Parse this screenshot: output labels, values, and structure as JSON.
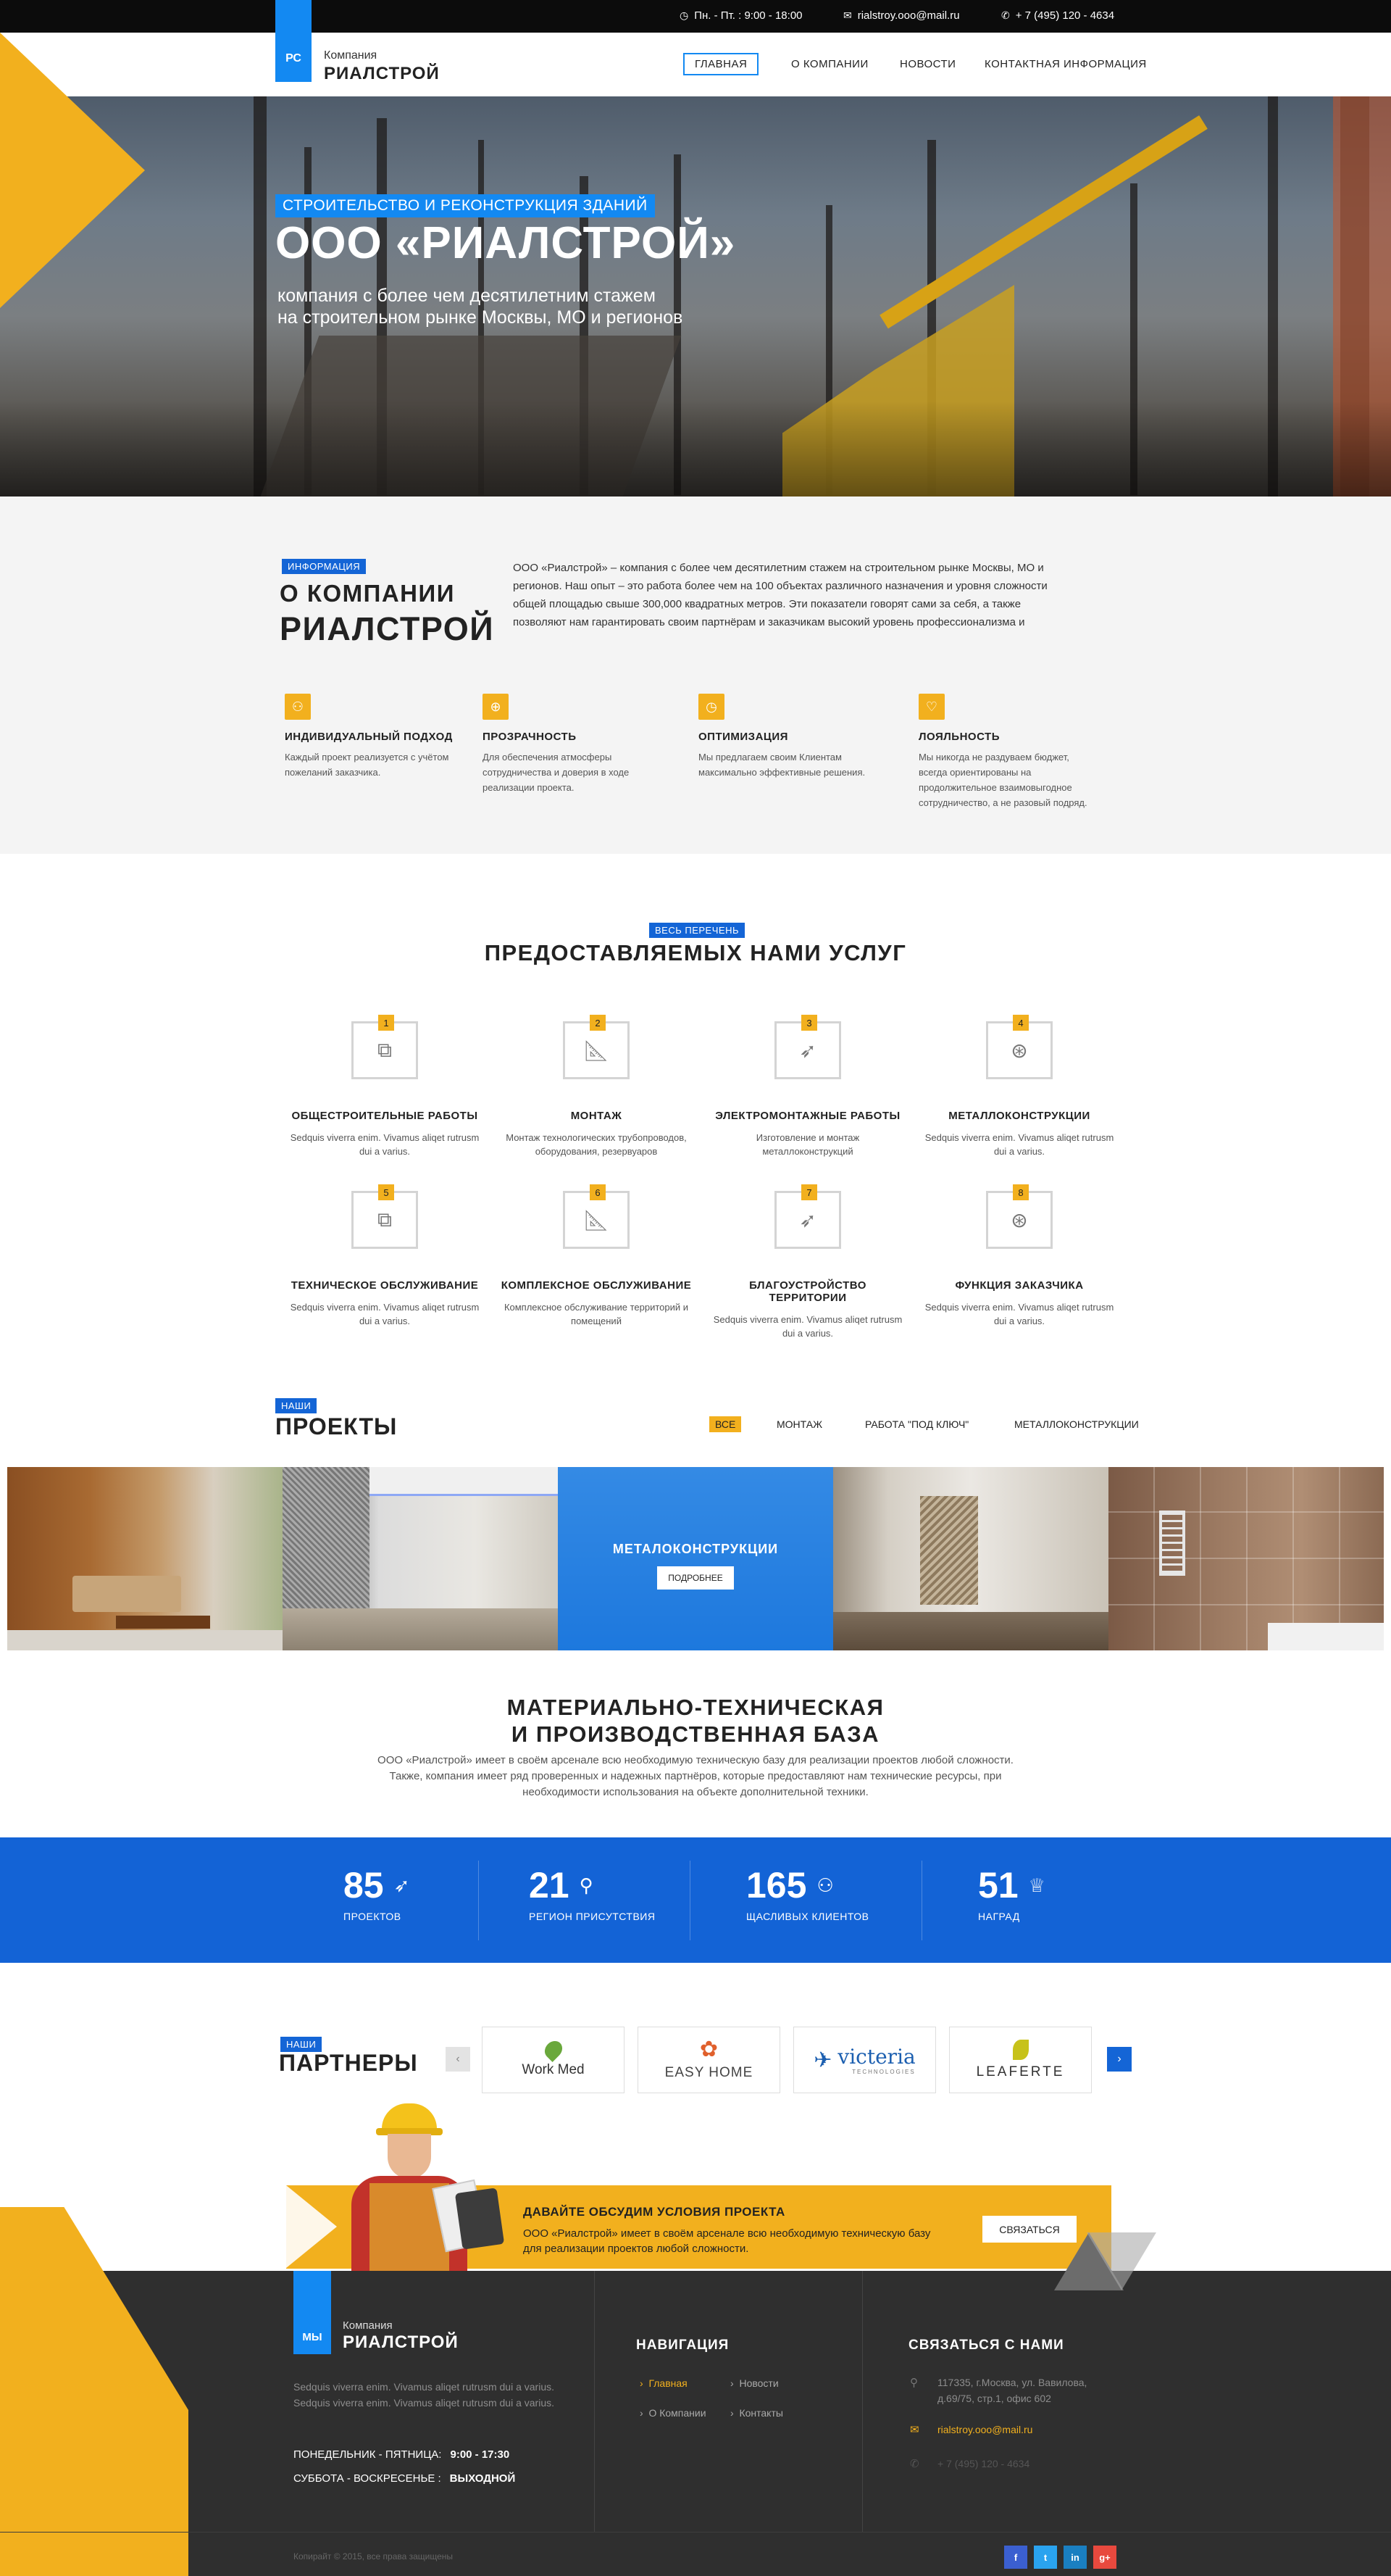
{
  "topbar": {
    "hours": "Пн. - Пт. : 9:00 - 18:00",
    "email": "rialstroy.ooo@mail.ru",
    "phone": "+ 7 (495) 120 - 4634"
  },
  "logo": {
    "abbr": "РС",
    "small": "Компания",
    "name": "РИАЛСТРОЙ"
  },
  "nav": [
    "ГЛАВНАЯ",
    "О КОМПАНИИ",
    "НОВОСТИ",
    "КОНТАКТНАЯ ИНФОРМАЦИЯ"
  ],
  "hero": {
    "tag": "СТРОИТЕЛЬСТВО И РЕКОНСТРУКЦИЯ ЗДАНИЙ",
    "title": "ООО «РИАЛСТРОЙ»",
    "sub1": "компания с более чем десятилетним стажем",
    "sub2": "на строительном рынке Москвы, МО и регионов"
  },
  "about": {
    "tag": "ИНФОРМАЦИЯ",
    "title1": "О КОМПАНИИ",
    "title2": "РИАЛСТРОЙ",
    "text": "ООО «Риалстрой» – компания с более чем десятилетним стажем на строительном рынке Москвы, МО и регионов. Наш опыт – это работа более чем на 100 объектах различного назначения и уровня сложности общей площадью свыше 300,000 квадратных метров. Эти показатели говорят сами за себя, а также позволяют нам гарантировать своим партнёрам и заказчикам высокий уровень профессионализма и",
    "features": [
      {
        "title": "ИНДИВИДУАЛЬНЫЙ ПОДХОД",
        "text": "Каждый проект реализуется с учётом пожеланий заказчика.",
        "icon": "user-icon"
      },
      {
        "title": "ПРОЗРАЧНОСТЬ",
        "text": "Для обеспечения атмосферы сотрудничества и доверия в ходе реализации проекта.",
        "icon": "globe-icon"
      },
      {
        "title": "ОПТИМИЗАЦИЯ",
        "text": "Мы предлагаем своим Клиентам максимально эффективные решения.",
        "icon": "clock-icon"
      },
      {
        "title": "ЛОЯЛЬНОСТЬ",
        "text": "Мы никогда не раздуваем бюджет, всегда ориентированы на продолжительное взаимовыгодное сотрудничество, а не разовый подряд.",
        "icon": "heart-icon"
      }
    ]
  },
  "services": {
    "tag": "ВЕСЬ ПЕРЕЧЕНЬ",
    "title": "ПРЕДОСТАВЛЯЕМЫХ НАМИ УСЛУГ",
    "items": [
      {
        "num": "1",
        "title": "ОБЩЕСТРОИТЕЛЬНЫЕ РАБОТЫ",
        "text": "Sedquis viverra enim. Vivamus aliqet rutrusm dui a varius.",
        "icon": "copy-icon"
      },
      {
        "num": "2",
        "title": "МОНТАЖ",
        "text": "Монтаж технологических трубопроводов, оборудования, резервуаров",
        "icon": "ruler-icon"
      },
      {
        "num": "3",
        "title": "ЭЛЕКТРОМОНТАЖНЫЕ РАБОТЫ",
        "text": "Изготовление и монтаж металлоконструкций",
        "icon": "rocket-icon"
      },
      {
        "num": "4",
        "title": "МЕТАЛЛОКОНСТРУКЦИИ",
        "text": "Sedquis viverra enim. Vivamus aliqet rutrusm dui a varius.",
        "icon": "lifebuoy-icon"
      },
      {
        "num": "5",
        "title": "ТЕХНИЧЕСКОЕ ОБСЛУЖИВАНИЕ",
        "text": "Sedquis viverra enim. Vivamus aliqet rutrusm dui a varius.",
        "icon": "copy-icon"
      },
      {
        "num": "6",
        "title": "КОМПЛЕКСНОЕ ОБСЛУЖИВАНИЕ",
        "text": "Комплексное обслуживание территорий и помещений",
        "icon": "ruler-icon"
      },
      {
        "num": "7",
        "title": "БЛАГОУСТРОЙСТВО ТЕРРИТОРИИ",
        "text": "Sedquis viverra enim. Vivamus aliqet rutrusm dui a varius.",
        "icon": "rocket-icon"
      },
      {
        "num": "8",
        "title": "ФУНКЦИЯ ЗАКАЗЧИКА",
        "text": "Sedquis viverra enim. Vivamus aliqet rutrusm dui a varius.",
        "icon": "lifebuoy-icon"
      }
    ]
  },
  "projects": {
    "tag": "НАШИ",
    "title": "ПРОЕКТЫ",
    "filters": [
      "ВСЕ",
      "МОНТАЖ",
      "РАБОТА \"ПОД КЛЮЧ\"",
      "МЕТАЛЛОКОНСТРУКЦИИ"
    ],
    "overlay_title": "МЕТАЛОКОНСТРУКЦИИ",
    "overlay_button": "ПОДРОБНЕЕ"
  },
  "base": {
    "title1": "МАТЕРИАЛЬНО-ТЕХНИЧЕСКАЯ",
    "title2": "И ПРОИЗВОДСТВЕННАЯ БАЗА",
    "text": "ООО «Риалстрой» имеет в своём арсенале всю необходимую техническую базу для реализации проектов любой сложности. Также, компания имеет ряд проверенных и надежных партнёров, которые предоставляют нам технические ресурсы, при необходимости использования на объекте дополнительной техники."
  },
  "stats": [
    {
      "value": "85",
      "label": "ПРОЕКТОВ",
      "icon": "rocket-icon"
    },
    {
      "value": "21",
      "label": "РЕГИОН ПРИСУТСТВИЯ",
      "icon": "bulb-icon"
    },
    {
      "value": "165",
      "label": "ЩАСЛИВЫХ КЛИЕНТОВ",
      "icon": "user-icon"
    },
    {
      "value": "51",
      "label": "НАГРАД",
      "icon": "trophy-icon"
    }
  ],
  "partners": {
    "tag": "НАШИ",
    "title": "ПАРТНЕРЫ",
    "logos": [
      "Work Med",
      "EASY HOME",
      "victeria",
      "LEAFERTE"
    ],
    "victeria_sub": "TECHNOLOGIES"
  },
  "cta": {
    "title": "ДАВАЙТЕ ОБСУДИМ УСЛОВИЯ ПРОЕКТА",
    "text": "ООО «Риалстрой» имеет в своём арсенале всю необходимую техническую базу для реализации проектов любой сложности.",
    "button": "СВЯЗАТЬСЯ"
  },
  "footer": {
    "logo_abbr": "МЫ",
    "logo_small": "Компания",
    "logo_name": "РИАЛСТРОЙ",
    "text": "Sedquis viverra enim. Vivamus aliqet rutrusm dui a varius. Sedquis viverra enim. Vivamus aliqet rutrusm dui a varius.",
    "hours1_label": "ПОНЕДЕЛЬНИК - ПЯТНИЦА:",
    "hours1_value": "9:00 - 17:30",
    "hours2_label": "СУББОТА - ВОСКРЕСЕНЬЕ :",
    "hours2_value": "ВЫХОДНОЙ",
    "nav_title": "НАВИГАЦИЯ",
    "nav": [
      "Главная",
      "Новости",
      "О Компании",
      "Контакты"
    ],
    "contact_title": "Связаться с нами",
    "address": "117335, г.Москва, ул. Вавилова, д.69/75, стр.1, офис 602",
    "email": "rialstroy.ooo@mail.ru",
    "phone": "+ 7 (495) 120 - 4634",
    "copyright": "Копирайт © 2015, все права защищены",
    "social": [
      "f",
      "t",
      "in",
      "g+"
    ]
  },
  "colors": {
    "yellow": "#f2b01e",
    "blue": "#1389f2",
    "stats_blue": "#1363d6",
    "dark": "#2f2f2f"
  }
}
